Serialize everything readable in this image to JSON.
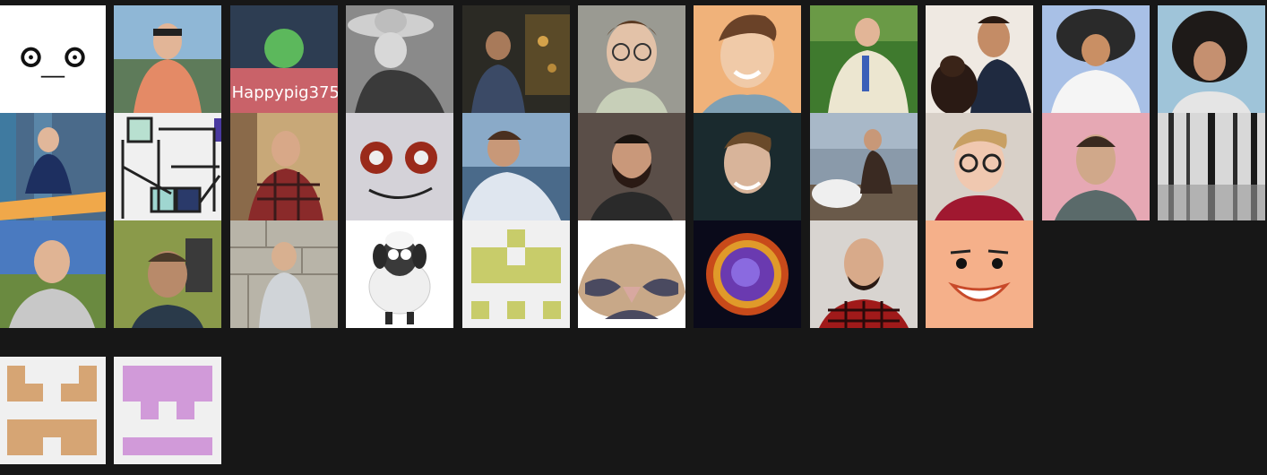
{
  "gallery": {
    "rows": [
      [
        {
          "name": "avatar-ascii-face",
          "text": "ʘ_ʘ",
          "bg": "#ffffff"
        },
        {
          "name": "avatar-person-orange-shirt"
        },
        {
          "name": "avatar-happypig375",
          "text": "Happypig375"
        },
        {
          "name": "avatar-person-sombrero"
        },
        {
          "name": "avatar-person-arcade"
        },
        {
          "name": "avatar-person-glasses"
        },
        {
          "name": "avatar-person-smiling"
        },
        {
          "name": "avatar-person-lying-grass"
        },
        {
          "name": "avatar-person-nasa-dog"
        },
        {
          "name": "avatar-person-feather-headdress"
        },
        {
          "name": "avatar-person-curly-hair"
        }
      ],
      [
        {
          "name": "avatar-person-meditating"
        },
        {
          "name": "avatar-geometric-lines"
        },
        {
          "name": "avatar-person-plaid-shirt"
        },
        {
          "name": "avatar-donut-eyes-face"
        },
        {
          "name": "avatar-person-sea"
        },
        {
          "name": "avatar-person-beard-brick"
        },
        {
          "name": "avatar-person-dark-bg"
        },
        {
          "name": "avatar-person-beach-rocks"
        },
        {
          "name": "avatar-person-blond-glasses"
        },
        {
          "name": "avatar-person-pink-wall"
        },
        {
          "name": "avatar-snowy-forest"
        }
      ],
      [
        {
          "name": "avatar-person-outdoor"
        },
        {
          "name": "avatar-person-green-wall"
        },
        {
          "name": "avatar-person-stone-wall"
        },
        {
          "name": "avatar-sheep-cartoon"
        },
        {
          "name": "avatar-identicon-green"
        },
        {
          "name": "avatar-bird-cartoon"
        },
        {
          "name": "avatar-nebula"
        },
        {
          "name": "avatar-person-red-plaid"
        },
        {
          "name": "avatar-cartoon-face"
        }
      ],
      [
        {
          "name": "avatar-identicon-tan"
        },
        {
          "name": "avatar-identicon-purple"
        }
      ]
    ]
  },
  "colors": {
    "background": "#171717",
    "identicon_green": "#c8cc6a",
    "identicon_tan": "#d6a574",
    "identicon_purple": "#d19ad9",
    "happypig_top": "#2d3d52",
    "happypig_bottom": "#c96269",
    "happypig_dot": "#5cb85c"
  }
}
